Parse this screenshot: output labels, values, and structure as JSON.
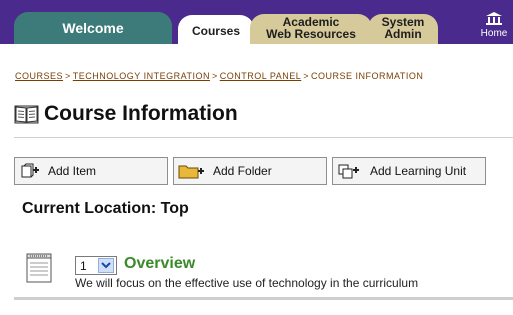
{
  "nav": {
    "tabs": [
      {
        "label": "Welcome"
      },
      {
        "label": "Courses"
      },
      {
        "line1": "Academic",
        "line2": "Web Resources"
      },
      {
        "line1": "System",
        "line2": "Admin"
      }
    ],
    "home_label": "Home",
    "colors": {
      "bar": "#4a2a8c",
      "welcome_tab": "#3d7b7b",
      "inactive_tab": "#d6c99a",
      "active_tab": "#ffffff"
    }
  },
  "breadcrumb": {
    "items": [
      "COURSES",
      "TECHNOLOGY INTEGRATION",
      "CONTROL PANEL",
      "COURSE INFORMATION"
    ],
    "separator": ">"
  },
  "page": {
    "title": "Course Information",
    "title_icon": "book-icon"
  },
  "toolbar": {
    "add_item": {
      "label": "Add Item",
      "icon": "add-item-icon"
    },
    "add_folder": {
      "label": "Add Folder",
      "icon": "add-folder-icon"
    },
    "add_learning_unit": {
      "label": "Add Learning Unit",
      "icon": "add-learning-unit-icon"
    }
  },
  "location": {
    "text": "Current Location: Top"
  },
  "items": [
    {
      "order": "1",
      "title": "Overview",
      "description": "We will focus on the effective use of technology in the curriculum",
      "icon": "document-icon",
      "title_color": "#3a8a2a"
    }
  ]
}
